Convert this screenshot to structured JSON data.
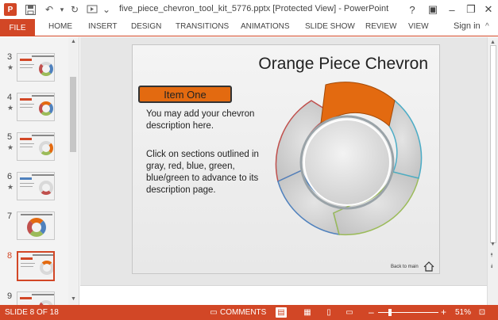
{
  "window": {
    "title": "five_piece_chevron_tool_kit_5776.pptx [Protected View] - PowerPoint",
    "app_icon": "P",
    "help": "?",
    "minimize": "–",
    "restore": "❐",
    "close": "✕",
    "ribbon_display_icon": "▣"
  },
  "quick_access": {
    "save_icon": "floppy-disk-icon",
    "undo": "↶",
    "redo": "↻",
    "customize": "⌄"
  },
  "ribbon": {
    "file": "FILE",
    "tabs": [
      "HOME",
      "INSERT",
      "DESIGN",
      "TRANSITIONS",
      "ANIMATIONS",
      "SLIDE SHOW",
      "REVIEW",
      "VIEW"
    ],
    "sign_in": "Sign in",
    "collapse_caret": "^"
  },
  "thumbnails": [
    {
      "number": "3",
      "star": "★"
    },
    {
      "number": "4",
      "star": "★"
    },
    {
      "number": "5",
      "star": "★"
    },
    {
      "number": "6",
      "star": "★"
    },
    {
      "number": "7",
      "star": ""
    },
    {
      "number": "8",
      "star": ""
    },
    {
      "number": "9",
      "star": ""
    }
  ],
  "selected_slide": "8",
  "slide": {
    "title": "Orange Piece Chevron",
    "item_button": "Item One",
    "description": "You may add your chevron description here.",
    "instructions": "Click on sections outlined in gray, red, blue, green, blue/green to advance to its description page.",
    "back_link": "Back to main",
    "colors": {
      "orange_piece": "#e36a10",
      "gray_piece": "#d2d2d2",
      "outline_red": "#c0504d",
      "outline_blue": "#4f81bd",
      "outline_green": "#9bbb59",
      "outline_teal": "#4bacc6"
    }
  },
  "status": {
    "slide_info": "SLIDE 8 OF 18",
    "comments": "COMMENTS",
    "zoom_minus": "–",
    "zoom_plus": "+",
    "zoom": "51%",
    "zoom_level_percent": 51
  },
  "accent_color": "#d24726"
}
